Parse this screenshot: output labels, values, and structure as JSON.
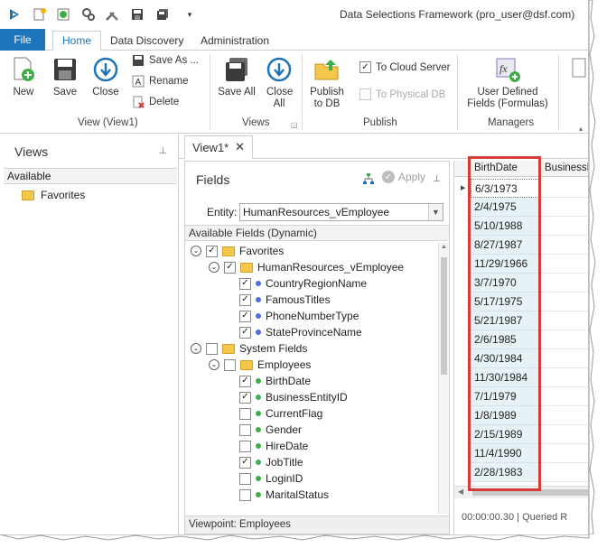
{
  "window": {
    "title": "Data Selections Framework (pro_user@dsf.com)"
  },
  "ribbon_tabs": [
    {
      "label": "File"
    },
    {
      "label": "Home"
    },
    {
      "label": "Data Discovery"
    },
    {
      "label": "Administration"
    }
  ],
  "ribbon": {
    "new_label": "New",
    "save_label": "Save",
    "close_label": "Close",
    "save_as_label": "Save As ...",
    "rename_label": "Rename",
    "delete_label": "Delete",
    "group_view_label": "View (View1)",
    "save_all_label": "Save All",
    "close_all_label": "Close All",
    "group_views_label": "Views",
    "publish_to_db_label": "Publish to DB",
    "to_cloud_server_label": "To Cloud Server",
    "to_physical_db_label": "To Physical DB",
    "group_publish_label": "Publish",
    "user_defined_fields_label": "User Defined Fields (Formulas)",
    "group_managers_label": "Managers"
  },
  "views_panel": {
    "title": "Views",
    "available_label": "Available",
    "items": [
      {
        "label": "Favorites"
      }
    ]
  },
  "document_tab": {
    "label": "View1*"
  },
  "fields_panel": {
    "title": "Fields",
    "apply_label": "Apply",
    "entity_label": "Entity:",
    "entity_value": "HumanResources_vEmployee",
    "available_fields_label": "Available Fields (Dynamic)",
    "viewpoint_label": "Viewpoint: Employees",
    "tree": [
      {
        "label": "Favorites",
        "kind": "folder",
        "level": 0,
        "checked": true
      },
      {
        "label": "HumanResources_vEmployee",
        "kind": "folder",
        "level": 1,
        "checked": true
      },
      {
        "label": "CountryRegionName",
        "kind": "field",
        "level": 2,
        "checked": true
      },
      {
        "label": "FamousTitles",
        "kind": "field",
        "level": 2,
        "checked": true
      },
      {
        "label": "PhoneNumberType",
        "kind": "field",
        "level": 2,
        "checked": true
      },
      {
        "label": "StateProvinceName",
        "kind": "field",
        "level": 2,
        "checked": true
      },
      {
        "label": "System Fields",
        "kind": "folder",
        "level": 0,
        "checked": false
      },
      {
        "label": "Employees",
        "kind": "folder",
        "level": 1,
        "checked": false
      },
      {
        "label": "BirthDate",
        "kind": "field",
        "level": 2,
        "checked": true
      },
      {
        "label": "BusinessEntityID",
        "kind": "field",
        "level": 2,
        "checked": true
      },
      {
        "label": "CurrentFlag",
        "kind": "field",
        "level": 2,
        "checked": false
      },
      {
        "label": "Gender",
        "kind": "field",
        "level": 2,
        "checked": false
      },
      {
        "label": "HireDate",
        "kind": "field",
        "level": 2,
        "checked": false
      },
      {
        "label": "JobTitle",
        "kind": "field",
        "level": 2,
        "checked": true
      },
      {
        "label": "LoginID",
        "kind": "field",
        "level": 2,
        "checked": false
      },
      {
        "label": "MaritalStatus",
        "kind": "field",
        "level": 2,
        "checked": false
      }
    ]
  },
  "grid": {
    "columns": [
      "BirthDate",
      "BusinessE"
    ],
    "rows": [
      "6/3/1973",
      "2/4/1975",
      "5/10/1988",
      "8/27/1987",
      "11/29/1966",
      "3/7/1970",
      "5/17/1975",
      "5/21/1987",
      "2/6/1985",
      "4/30/1984",
      "11/30/1984",
      "7/1/1979",
      "1/8/1989",
      "2/15/1989",
      "11/4/1990",
      "2/28/1983"
    ],
    "status_text": "00:00:00.30 | Queried R"
  },
  "colors": {
    "accent": "#1e74b8",
    "highlight_box": "#d93a3a",
    "cell_background": "#e7f2f7"
  }
}
